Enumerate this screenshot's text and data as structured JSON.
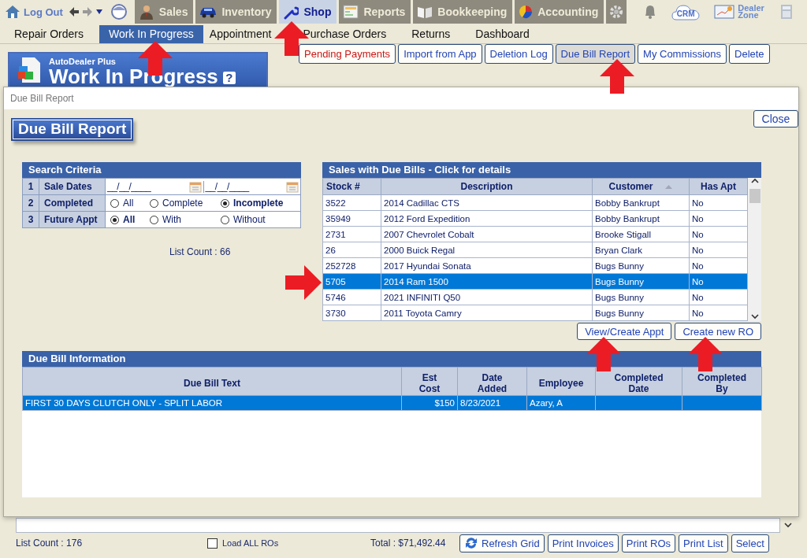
{
  "top_nav": {
    "logout": "Log Out",
    "modules": [
      {
        "label": "Sales",
        "selected": false
      },
      {
        "label": "Inventory",
        "selected": false
      },
      {
        "label": "Shop",
        "selected": true
      },
      {
        "label": "Reports",
        "selected": false
      },
      {
        "label": "Bookkeeping",
        "selected": false
      },
      {
        "label": "Accounting",
        "selected": false
      }
    ],
    "crm": "CRM",
    "dealer_zone": "Dealer Zone"
  },
  "sub_nav": [
    {
      "label": "Repair Orders",
      "selected": false
    },
    {
      "label": "Work In Progress",
      "selected": true
    },
    {
      "label": "Appointment",
      "selected": false
    },
    {
      "label": "Purchase Orders",
      "selected": false
    },
    {
      "label": "Returns",
      "selected": false
    },
    {
      "label": "Dashboard",
      "selected": false
    }
  ],
  "page_header": {
    "brand": "AutoDealer Plus",
    "title": "Work In Progress",
    "help": "?"
  },
  "toolbar": [
    {
      "label": "Pending Payments",
      "kind": "alert",
      "pressed": false
    },
    {
      "label": "Import from App",
      "kind": "normal",
      "pressed": false
    },
    {
      "label": "Deletion Log",
      "kind": "normal",
      "pressed": false
    },
    {
      "label": "Due Bill Report",
      "kind": "normal",
      "pressed": true
    },
    {
      "label": "My Commissions",
      "kind": "normal",
      "pressed": false
    },
    {
      "label": "Delete",
      "kind": "normal",
      "pressed": false
    }
  ],
  "dialog": {
    "title": "Due Bill Report",
    "close": "Close",
    "heading": "Due Bill Report",
    "search": {
      "title": "Search Criteria",
      "rows": [
        {
          "number": "1",
          "label": "Sale Dates",
          "kind": "dates",
          "fields": [
            {
              "value": "__/__/____"
            },
            {
              "value": "__/__/____"
            }
          ]
        },
        {
          "number": "2",
          "label": "Completed",
          "kind": "radios",
          "options": [
            {
              "label": "All",
              "selected": false
            },
            {
              "label": "Complete",
              "selected": false
            },
            {
              "label": "Incomplete",
              "selected": true
            }
          ]
        },
        {
          "number": "3",
          "label": "Future Appt",
          "kind": "radios",
          "options": [
            {
              "label": "All",
              "selected": true
            },
            {
              "label": "With",
              "selected": false
            },
            {
              "label": "Without",
              "selected": false
            }
          ]
        }
      ]
    },
    "list_count": "List Count : 66",
    "sales": {
      "title": "Sales with Due Bills - Click for details",
      "columns": [
        {
          "label": "Stock #",
          "sorted": false
        },
        {
          "label": "Description",
          "sorted": false
        },
        {
          "label": "Customer",
          "sorted": true
        },
        {
          "label": "Has Apt",
          "sorted": false
        }
      ],
      "rows": [
        {
          "cells": [
            "3522",
            "2014 Cadillac CTS",
            "Bobby Bankrupt",
            "No"
          ],
          "selected": false
        },
        {
          "cells": [
            "35949",
            "2012 Ford Expedition",
            "Bobby Bankrupt",
            "No"
          ],
          "selected": false
        },
        {
          "cells": [
            "2731",
            "2007 Chevrolet Cobalt",
            "Brooke Stigall",
            "No"
          ],
          "selected": false
        },
        {
          "cells": [
            "26",
            "2000 Buick Regal",
            "Bryan Clark",
            "No"
          ],
          "selected": false
        },
        {
          "cells": [
            "252728",
            "2017 Hyundai Sonata",
            "Bugs Bunny",
            "No"
          ],
          "selected": false
        },
        {
          "cells": [
            "5705",
            "2014 Ram 1500",
            "Bugs Bunny",
            "No"
          ],
          "selected": true
        },
        {
          "cells": [
            "5746",
            "2021 INFINITI Q50",
            "Bugs Bunny",
            "No"
          ],
          "selected": false
        },
        {
          "cells": [
            "3730",
            "2011 Toyota Camry",
            "Bugs Bunny",
            "No"
          ],
          "selected": false
        }
      ]
    },
    "buttons": [
      "View/Create Appt",
      "Create new RO"
    ],
    "info": {
      "title": "Due Bill Information",
      "columns": [
        "Due Bill Text",
        "Est Cost",
        "Date Added",
        "Employee",
        "Completed Date",
        "Completed By"
      ],
      "rows": [
        {
          "cells": [
            "FIRST 30 DAYS CLUTCH ONLY - SPLIT LABOR",
            "$150",
            "8/23/2021",
            "Azary, A",
            "",
            ""
          ],
          "selected": true
        }
      ]
    }
  },
  "footer": {
    "list_count": "List Count : 176",
    "load_all": {
      "label": "Load ALL ROs",
      "checked": false
    },
    "total": "Total : $71,492.44",
    "buttons": [
      {
        "label": "Refresh Grid",
        "kind": "refresh"
      },
      {
        "label": "Print Invoices",
        "kind": "plain"
      },
      {
        "label": "Print ROs",
        "kind": "plain"
      },
      {
        "label": "Print List",
        "kind": "plain"
      },
      {
        "label": "Select",
        "kind": "plain"
      }
    ]
  }
}
